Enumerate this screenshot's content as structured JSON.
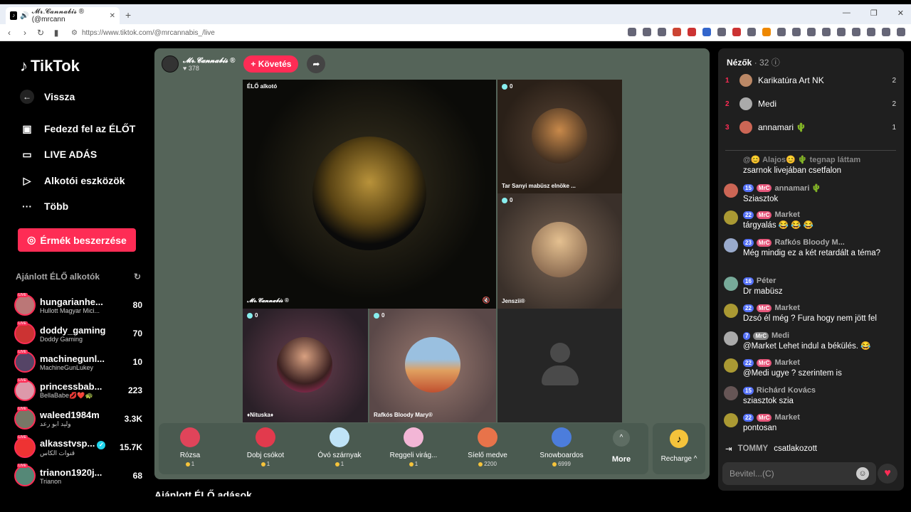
{
  "browser": {
    "tab_title": "𝓜𝓻.𝓒𝓪𝓷𝓷𝓪𝓫𝓲𝓼 ® (@mrcann",
    "url": "https://www.tiktok.com/@mrcannabis_/live"
  },
  "sidebar": {
    "logo": "TikTok",
    "back": "Vissza",
    "nav": [
      "Fedezd fel az ÉLŐT",
      "LIVE ADÁS",
      "Alkotói eszközök",
      "Több"
    ],
    "coins_button": "Érmék beszerzése",
    "recommended_title": "Ajánlott ÉLŐ alkotók",
    "creators": [
      {
        "name": "hungarianhe...",
        "sub": "Hullott Magyar Mici...",
        "count": "80"
      },
      {
        "name": "doddy_gaming",
        "sub": "Doddy Gaming",
        "count": "70"
      },
      {
        "name": "machinegunl...",
        "sub": "MachineGunLukey",
        "count": "10"
      },
      {
        "name": "princessbab...",
        "sub": "BellaBabe💋❤️🐢",
        "count": "223"
      },
      {
        "name": "waleed1984m",
        "sub": "وليد ابو رعد",
        "count": "3.3K"
      },
      {
        "name": "alkasstvsp...",
        "sub": "قنوات الكاس",
        "count": "15.7K"
      },
      {
        "name": "trianon1920j...",
        "sub": "Trianon",
        "count": "68"
      }
    ]
  },
  "stream": {
    "host_name": "𝓜𝓻.𝓒𝓪𝓷𝓷𝓪𝓫𝓲𝓼 ®",
    "host_likes": "♥ 378",
    "follow": "+ Követés",
    "main_tile_label": "ÉLŐ alkotó",
    "main_tile_name": "𝓜𝓻.𝓒𝓪𝓷𝓷𝓪𝓫𝓲𝓼 ®",
    "tiles": [
      {
        "count": "0",
        "name": "Tar Sanyi mabüsz elnöke ..."
      },
      {
        "count": "0",
        "name": "Jenszii®"
      },
      {
        "count": "0",
        "name": "♦Nituska♦"
      },
      {
        "count": "0",
        "name": "Rafkós Bloody Mary®"
      }
    ]
  },
  "gifts": [
    {
      "name": "Rózsa",
      "price": "1",
      "color": "#e0445a"
    },
    {
      "name": "Dobj csókot",
      "price": "1",
      "color": "#e23a4d"
    },
    {
      "name": "Óvó szárnyak",
      "price": "1",
      "color": "#bfe3f7"
    },
    {
      "name": "Reggeli virág...",
      "price": "1",
      "color": "#f3b6d6"
    },
    {
      "name": "Síelő medve",
      "price": "2200",
      "color": "#e8734a"
    },
    {
      "name": "Snowboardos",
      "price": "6999",
      "color": "#4c7ddc"
    }
  ],
  "more_label": "More",
  "recharge_label": "Recharge ^",
  "bottom_title": "Ajánlott ÉLŐ adások",
  "chat": {
    "viewers_label": "Nézők",
    "viewers_count": "· 32",
    "top_viewers": [
      {
        "rank": "1",
        "name": "Karikatúra Art NK",
        "count": "2"
      },
      {
        "rank": "2",
        "name": "Medi",
        "count": "2"
      },
      {
        "rank": "3",
        "name": "annamari 🌵",
        "count": "1"
      }
    ],
    "messages": [
      {
        "level": "",
        "fan": "",
        "name": "@😊 Alajos😊 🌵 tegnap láttam",
        "text": "zsarnok livejában csetfalon"
      },
      {
        "level": "15",
        "fan": "MrC",
        "name": "annamari 🌵",
        "text": "Sziasztok"
      },
      {
        "level": "22",
        "fan": "MrC",
        "name": "Market",
        "text": "tárgyalás 😂 😂 😂"
      },
      {
        "level": "23",
        "fan": "MrC",
        "name": "Rafkós Bloody M...",
        "text": "Még mindig ez a két retardált a téma?"
      },
      {
        "level": "16",
        "fan": "",
        "name": "Péter",
        "text": "Dr mabüsz"
      },
      {
        "level": "22",
        "fan": "MrC",
        "name": "Market",
        "text": "Dzsó él még ? Fura hogy nem jött fel"
      },
      {
        "level": "7",
        "fan": "MrC",
        "name": "Medi",
        "text": "@Market Lehet indul a békülés. 😂"
      },
      {
        "level": "22",
        "fan": "MrC",
        "name": "Market",
        "text": "@Medi ugye ? szerintem is"
      },
      {
        "level": "15",
        "fan": "",
        "name": "Richárd Kovács",
        "text": "sziasztok szia"
      },
      {
        "level": "22",
        "fan": "MrC",
        "name": "Market",
        "text": "pontosan"
      }
    ],
    "joined_name": "TOMMY",
    "joined_text": "csatlakozott",
    "input_placeholder": "Bevitel...(C)"
  }
}
